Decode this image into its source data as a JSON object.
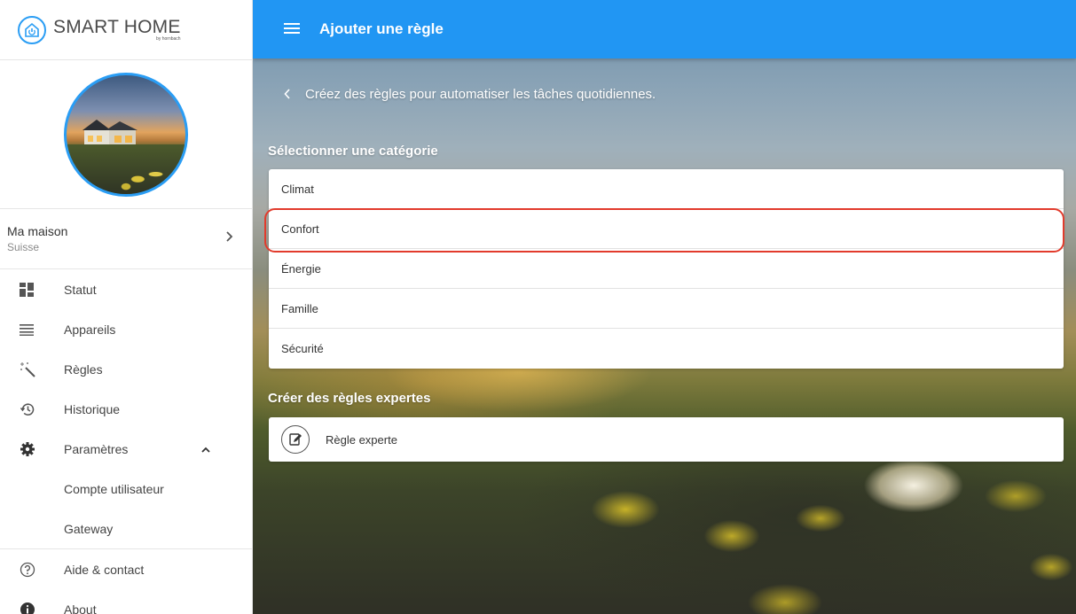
{
  "brand": {
    "name": "SMART HOME",
    "sub": "by hornbach",
    "color": "#2a9df4"
  },
  "home": {
    "name": "Ma maison",
    "country": "Suisse"
  },
  "nav": {
    "items": [
      {
        "label": "Statut",
        "icon": "dashboard-icon"
      },
      {
        "label": "Appareils",
        "icon": "list-icon"
      },
      {
        "label": "Règles",
        "icon": "magic-wand-icon"
      },
      {
        "label": "Historique",
        "icon": "history-icon"
      },
      {
        "label": "Paramètres",
        "icon": "gear-icon",
        "expanded": true
      }
    ],
    "settings_sub": [
      "Compte utilisateur",
      "Gateway"
    ],
    "bottom": [
      {
        "label": "Aide & contact",
        "icon": "help-icon"
      },
      {
        "label": "About",
        "icon": "info-icon"
      }
    ]
  },
  "topbar": {
    "title": "Ajouter une règle",
    "color": "#2196f3"
  },
  "intro": "Créez des règles pour automatiser les tâches quotidiennes.",
  "categories": {
    "title": "Sélectionner une catégorie",
    "items": [
      "Climat",
      "Confort",
      "Énergie",
      "Famille",
      "Sécurité"
    ],
    "highlighted": "Confort",
    "highlight_color": "#e23b2c"
  },
  "expert": {
    "title": "Créer des règles expertes",
    "item": "Règle experte"
  }
}
